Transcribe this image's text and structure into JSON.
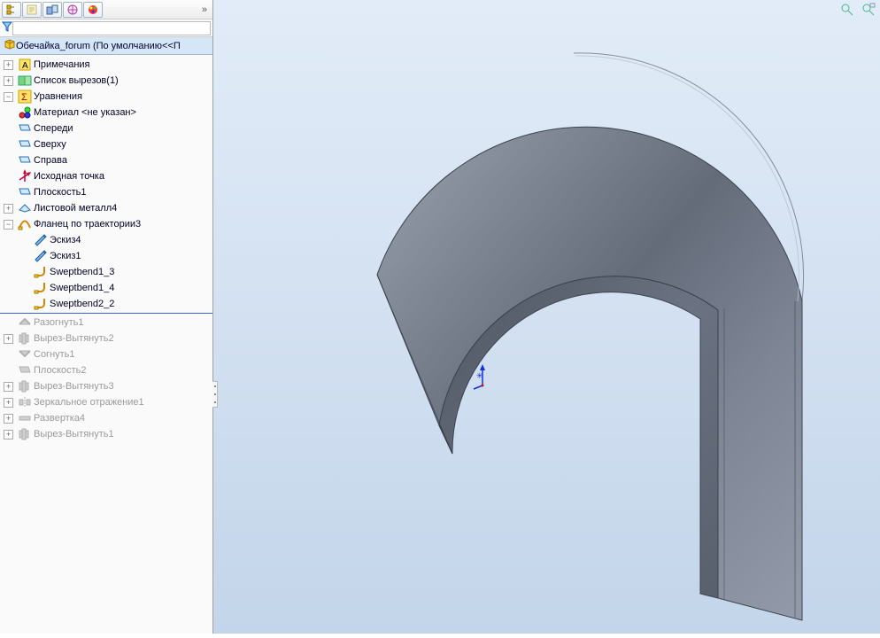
{
  "filter_placeholder": "",
  "tree_title_icon": "part-yellow",
  "tree_title": "Обечайка_forum  (По умолчанию<<П",
  "nodes": [
    {
      "indent": 1,
      "exp": "plus",
      "icon": "annotation",
      "label": "Примечания",
      "sup": false
    },
    {
      "indent": 1,
      "exp": "plus",
      "icon": "cutlist",
      "label": "Список вырезов(1)",
      "sup": false
    },
    {
      "indent": 1,
      "exp": "minus",
      "icon": "sigma",
      "label": "Уравнения",
      "sup": false
    },
    {
      "indent": 1,
      "exp": "none",
      "icon": "material",
      "label": "Материал <не указан>",
      "sup": false
    },
    {
      "indent": 1,
      "exp": "none",
      "icon": "plane",
      "label": "Спереди",
      "sup": false
    },
    {
      "indent": 1,
      "exp": "none",
      "icon": "plane",
      "label": "Сверху",
      "sup": false
    },
    {
      "indent": 1,
      "exp": "none",
      "icon": "plane",
      "label": "Справа",
      "sup": false
    },
    {
      "indent": 1,
      "exp": "none",
      "icon": "origin",
      "label": "Исходная точка",
      "sup": false
    },
    {
      "indent": 1,
      "exp": "none",
      "icon": "plane",
      "label": "Плоскость1",
      "sup": false
    },
    {
      "indent": 1,
      "exp": "plus",
      "icon": "sheetmetal",
      "label": "Листовой металл4",
      "sup": false
    },
    {
      "indent": 1,
      "exp": "minus",
      "icon": "swept",
      "label": "Фланец по траектории3",
      "sup": false
    },
    {
      "indent": 2,
      "exp": "none",
      "icon": "sketch",
      "label": "Эскиз4",
      "sup": false
    },
    {
      "indent": 2,
      "exp": "none",
      "icon": "sketch",
      "label": "Эскиз1",
      "sup": false
    },
    {
      "indent": 2,
      "exp": "none",
      "icon": "bend",
      "label": "Sweptbend1_3",
      "sup": false
    },
    {
      "indent": 2,
      "exp": "none",
      "icon": "bend",
      "label": "Sweptbend1_4",
      "sup": false
    },
    {
      "indent": 2,
      "exp": "none",
      "icon": "bend",
      "label": "Sweptbend2_2",
      "sup": false
    },
    {
      "separator": true
    },
    {
      "indent": 1,
      "exp": "none",
      "icon": "unfold",
      "label": "Разогнуть1",
      "sup": true
    },
    {
      "indent": 1,
      "exp": "plus",
      "icon": "cut-ext",
      "label": "Вырез-Вытянуть2",
      "sup": true
    },
    {
      "indent": 1,
      "exp": "none",
      "icon": "fold",
      "label": "Согнуть1",
      "sup": true
    },
    {
      "indent": 1,
      "exp": "none",
      "icon": "plane-sup",
      "label": "Плоскость2",
      "sup": true
    },
    {
      "indent": 1,
      "exp": "plus",
      "icon": "cut-ext",
      "label": "Вырез-Вытянуть3",
      "sup": true
    },
    {
      "indent": 1,
      "exp": "plus",
      "icon": "mirror",
      "label": "Зеркальное отражение1",
      "sup": true
    },
    {
      "indent": 1,
      "exp": "plus",
      "icon": "flat",
      "label": "Развертка4",
      "sup": true
    },
    {
      "indent": 1,
      "exp": "plus",
      "icon": "cut-ext",
      "label": "Вырез-Вытянуть1",
      "sup": true
    }
  ],
  "tab_icons": [
    "feature-tree-icon",
    "property-icon",
    "config-icon",
    "dimxpert-icon",
    "appearance-icon"
  ],
  "filter_icon_label": "▼"
}
